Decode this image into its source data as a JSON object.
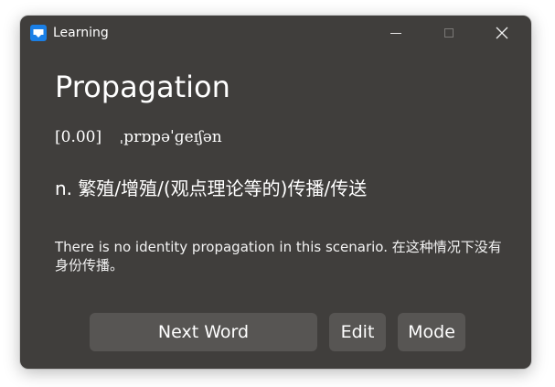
{
  "window": {
    "title": "Learning",
    "icon": "learning-app-icon",
    "controls": {
      "minimize": "minimize-icon",
      "maximize": "maximize-icon",
      "close": "close-icon"
    }
  },
  "card": {
    "word": "Propagation",
    "score": "[0.00]",
    "phonetic": "ˌprɒpəˈɡeɪʃən",
    "definition": "n. 繁殖/增殖/(观点理论等的)传播/传送",
    "example": "There is no identity propagation in this scenario. 在这种情况下没有身份传播。"
  },
  "buttons": {
    "next": "Next Word",
    "edit": "Edit",
    "mode": "Mode"
  },
  "colors": {
    "window_bg": "#403e3c",
    "button_bg": "#575553",
    "text": "#ffffff",
    "icon_blue": "#1a7fe6"
  }
}
